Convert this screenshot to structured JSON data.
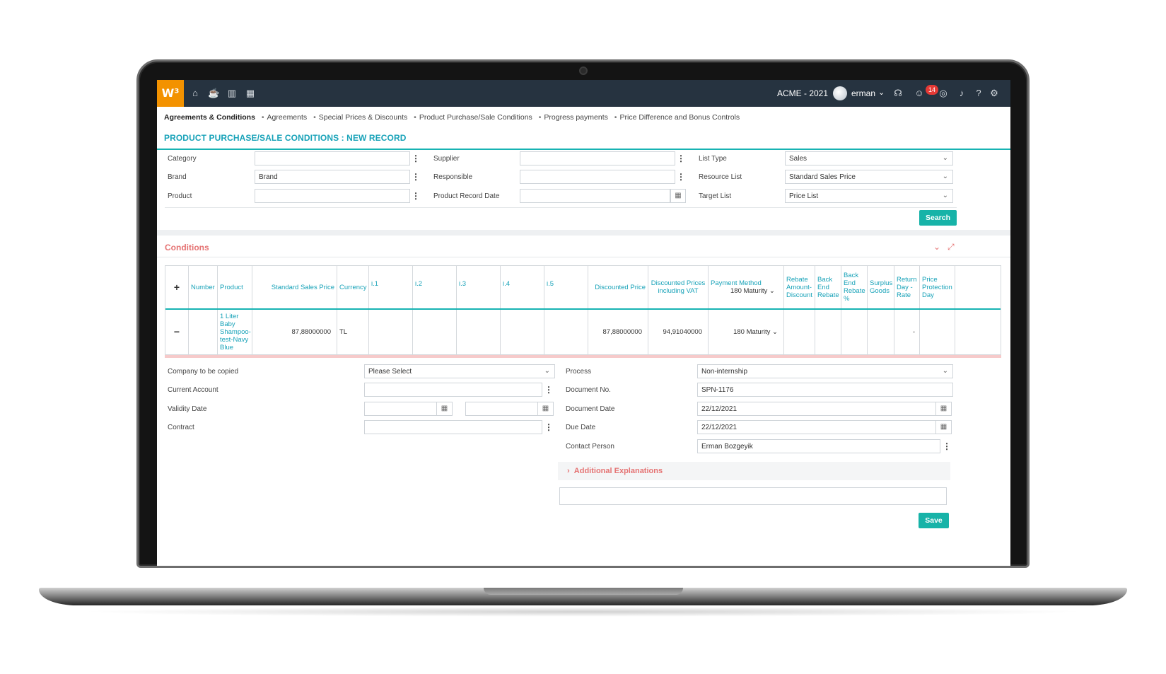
{
  "topbar": {
    "logo": "W³",
    "company": "ACME - 2021",
    "username": "erman",
    "notification_count": "14",
    "icons": [
      "home-icon",
      "cup-icon",
      "bar-chart-icon",
      "calendar-icon",
      "headset-icon",
      "smiley-icon",
      "chat-icon",
      "bell-icon",
      "help-icon",
      "gear-icon"
    ]
  },
  "breadcrumb": [
    "Agreements & Conditions",
    "Agreements",
    "Special Prices & Discounts",
    "Product Purchase/Sale Conditions",
    "Progress payments",
    "Price Difference and Bonus Controls"
  ],
  "page_title": "PRODUCT PURCHASE/SALE CONDITIONS : NEW RECORD",
  "filters": {
    "category_label": "Category",
    "category_value": "",
    "brand_label": "Brand",
    "brand_value": "Brand",
    "product_label": "Product",
    "product_value": "",
    "supplier_label": "Supplier",
    "supplier_value": "",
    "responsible_label": "Responsible",
    "responsible_value": "",
    "product_record_date_label": "Product Record Date",
    "product_record_date_value": "",
    "list_type_label": "List Type",
    "list_type_value": "Sales",
    "resource_list_label": "Resource List",
    "resource_list_value": "Standard Sales Price",
    "target_list_label": "Target List",
    "target_list_value": "Price List",
    "search_label": "Search"
  },
  "conditions": {
    "title": "Conditions",
    "columns": {
      "add": "+",
      "number": "Number",
      "product": "Product",
      "standard_sales_price": "Standard Sales Price",
      "currency": "Currency",
      "i1": "i.1",
      "i2": "i.2",
      "i3": "i.3",
      "i4": "i.4",
      "i5": "i.5",
      "discounted_price": "Discounted Price",
      "discounted_vat": "Discounted Prices including VAT",
      "payment_method": "Payment Method",
      "payment_method_value": "180 Maturity",
      "rebate_amount": "Rebate Amount-Discount",
      "back_end_rebate": "Back End Rebate",
      "back_end_rebate_pct": "Back End Rebate %",
      "surplus_goods": "Surplus Goods",
      "return_day_rate": "Return Day - Rate",
      "price_protection_day": "Price Protection Day"
    },
    "rows": [
      {
        "remove": "−",
        "number": "",
        "product": "1 Liter Baby Shampoo-test-Navy Blue",
        "standard_sales_price": "87,88000000",
        "currency": "TL",
        "discounted_price": "87,88000000",
        "discounted_vat": "94,91040000",
        "payment_method": "180 Maturity",
        "return_day_rate": "-"
      }
    ]
  },
  "details": {
    "company_copied_label": "Company to be copied",
    "company_copied_value": "Please Select",
    "current_account_label": "Current Account",
    "validity_date_label": "Validity Date",
    "contract_label": "Contract",
    "process_label": "Process",
    "process_value": "Non-internship",
    "document_no_label": "Document No.",
    "document_no_value": "SPN-1176",
    "document_date_label": "Document Date",
    "document_date_value": "22/12/2021",
    "due_date_label": "Due Date",
    "due_date_value": "22/12/2021",
    "contact_person_label": "Contact Person",
    "contact_person_value": "Erman Bozgeyik",
    "additional_explanations": "Additional Explanations",
    "save_label": "Save"
  },
  "colors": {
    "accent": "#17b3a8",
    "title": "#17a2b8",
    "section": "#e57373",
    "logo": "#f39200",
    "topbar": "#263340"
  }
}
